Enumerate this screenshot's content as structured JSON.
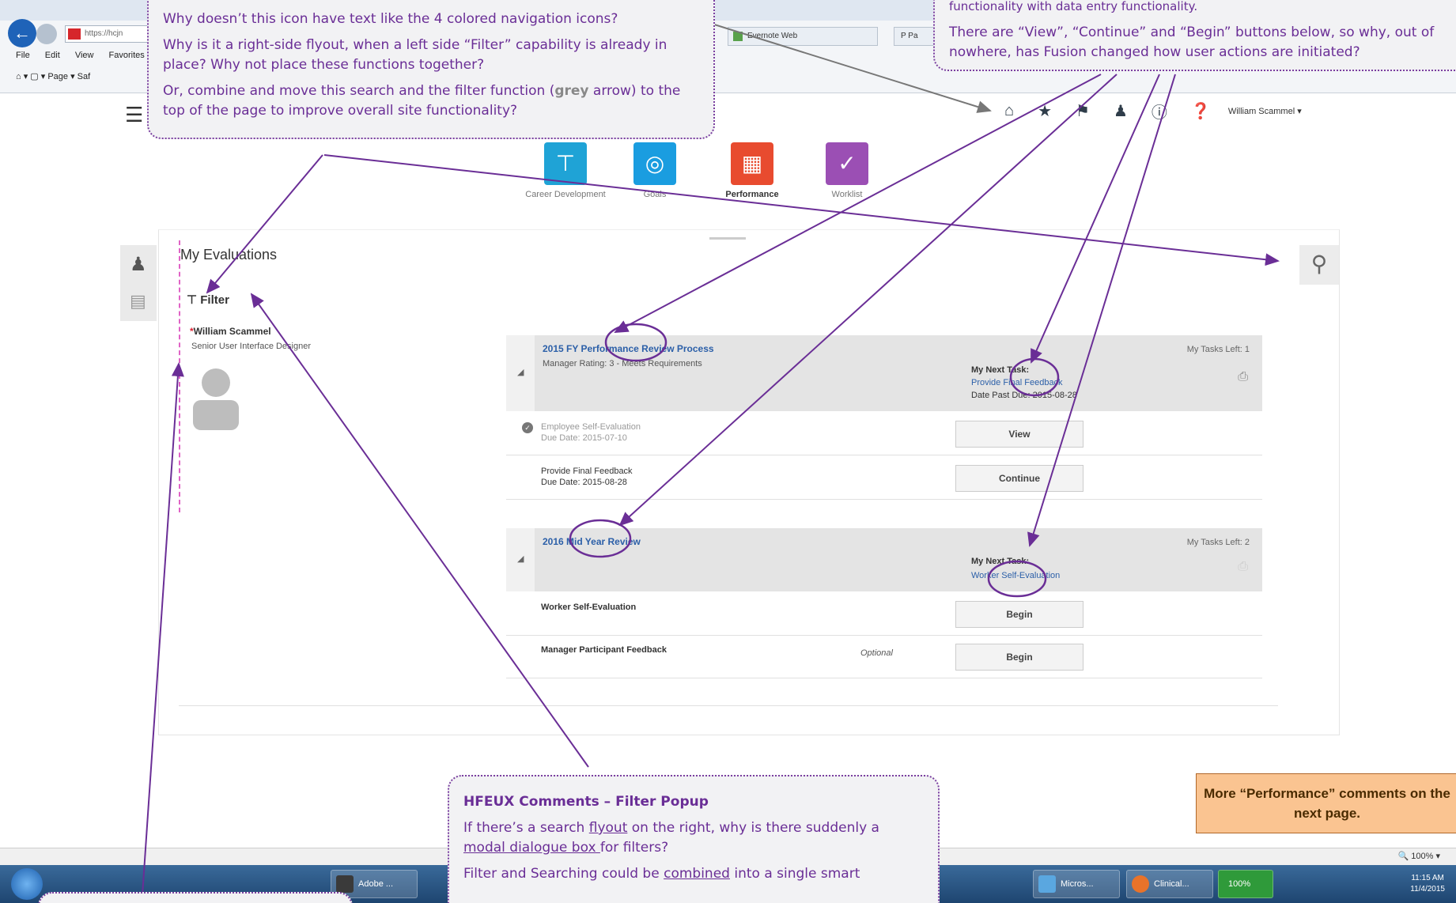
{
  "browser": {
    "address": "https://hcjn",
    "tabs": [
      "Evernote Web",
      "P Pa"
    ],
    "menu": [
      "File",
      "Edit",
      "View",
      "Favorites"
    ],
    "cmd": "Page ▾  Saf"
  },
  "header": {
    "icons": [
      "home-icon",
      "star-icon",
      "flag-icon",
      "person-icon",
      "info-icon",
      "help-icon"
    ],
    "user": "William Scammel ▾"
  },
  "nav": [
    {
      "label": "Career Development",
      "color": "#1fa3d6",
      "active": false
    },
    {
      "label": "Goals",
      "color": "#1a9de0",
      "active": false
    },
    {
      "label": "Performance",
      "color": "#e84b2f",
      "active": true
    },
    {
      "label": "Worklist",
      "color": "#9b4fb4",
      "active": false
    }
  ],
  "main": {
    "title": "My Evaluations",
    "filter_label": "Filter",
    "person_name": "William Scammel",
    "person_title": "Senior User Interface Designer",
    "groups": [
      {
        "title": "2015 FY Performance Review Process",
        "subtitle": "Manager Rating: 3 - Meets Requirements",
        "tasks_left": "My Tasks Left: 1",
        "next_task_heading": "My Next Task:",
        "next_task_link": "Provide Final Feedback",
        "next_task_due": "Date Past Due: 2015-08-28",
        "rows": [
          {
            "name": "Employee Self-Evaluation",
            "due": "Due Date: 2015-07-10",
            "button": "View",
            "completed": true,
            "optional": ""
          },
          {
            "name": "Provide Final Feedback",
            "due": "Due Date: 2015-08-28",
            "button": "Continue",
            "completed": false,
            "optional": ""
          }
        ]
      },
      {
        "title": "2016 Mid Year Review",
        "subtitle": "",
        "tasks_left": "My Tasks Left: 2",
        "next_task_heading": "My Next Task:",
        "next_task_link": "Worker Self-Evaluation",
        "next_task_due": "",
        "rows": [
          {
            "name": "Worker Self-Evaluation",
            "due": "",
            "button": "Begin",
            "completed": false,
            "optional": ""
          },
          {
            "name": "Manager Participant Feedback",
            "due": "",
            "button": "Begin",
            "completed": false,
            "optional": "Optional"
          }
        ]
      }
    ]
  },
  "statusbar": {
    "zoom": "🔍 100%  ▾"
  },
  "taskbar": {
    "items": [
      "Adobe ...",
      "Micros...",
      "Clinical...",
      "100%"
    ],
    "time": "11:15 AM",
    "date": "11/4/2015"
  },
  "annotations": {
    "top_left": [
      "Why doesn’t this icon have text like the 4 colored navigation icons?",
      "Why is it a right-side flyout, when a left side “Filter” capability is already in place? Why not place these functions together?",
      "Or, combine and move this search and the filter function (",
      "grey",
      " arrow) to the top of the page to improve overall site functionality?"
    ],
    "top_right": [
      "functionality with data entry functionality.",
      "There are “View”, “Continue” and “Begin” buttons below, so why, out of nowhere, has Fusion changed how user actions are initiated?"
    ],
    "bottom_center": {
      "heading": "HFEUX Comments – Filter Popup",
      "p1a": "If there’s a search ",
      "p1b": "flyout",
      "p1c": " on the right, why is there suddenly a ",
      "p1d": "modal dialogue box ",
      "p1e": "for filters?",
      "p2a": "Filter and Searching could be ",
      "p2b": "combined",
      "p2c": " into a single smart"
    },
    "more_box": "More “Performance” comments on the next page."
  }
}
